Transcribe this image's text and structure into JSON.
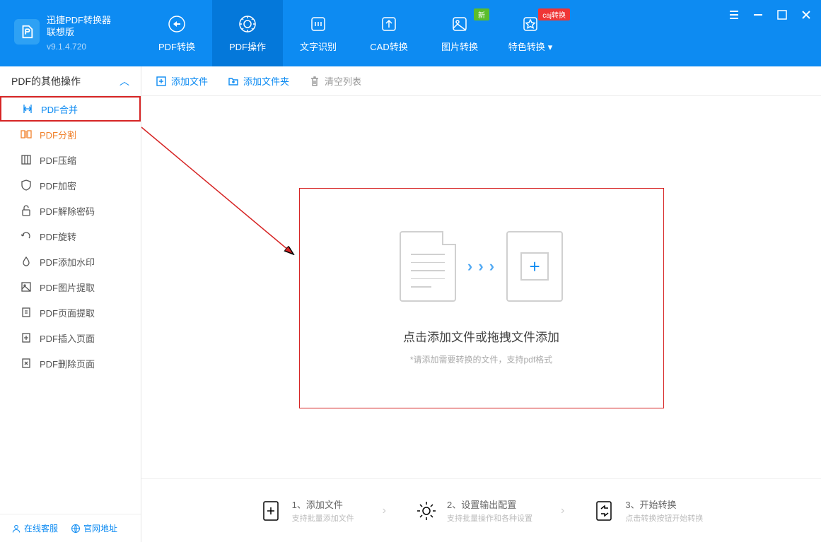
{
  "app": {
    "name": "迅捷PDF转换器\n联想版",
    "version": "v9.1.4.720"
  },
  "nav_tabs": [
    {
      "label": "PDF转换"
    },
    {
      "label": "PDF操作"
    },
    {
      "label": "文字识别"
    },
    {
      "label": "CAD转换"
    },
    {
      "label": "图片转换",
      "badge": "新"
    },
    {
      "label": "特色转换",
      "badge": "caj转换",
      "caret": true
    }
  ],
  "sidebar": {
    "header": "PDF的其他操作",
    "items": [
      {
        "label": "PDF合并"
      },
      {
        "label": "PDF分割"
      },
      {
        "label": "PDF压缩"
      },
      {
        "label": "PDF加密"
      },
      {
        "label": "PDF解除密码"
      },
      {
        "label": "PDF旋转"
      },
      {
        "label": "PDF添加水印"
      },
      {
        "label": "PDF图片提取"
      },
      {
        "label": "PDF页面提取"
      },
      {
        "label": "PDF插入页面"
      },
      {
        "label": "PDF删除页面"
      }
    ],
    "footer": {
      "support": "在线客服",
      "website": "官网地址"
    }
  },
  "toolbar": {
    "add_file": "添加文件",
    "add_folder": "添加文件夹",
    "clear_list": "清空列表"
  },
  "dropzone": {
    "title": "点击添加文件或拖拽文件添加",
    "subtitle": "*请添加需要转换的文件，支持pdf格式"
  },
  "steps": [
    {
      "title": "1、添加文件",
      "subtitle": "支持批量添加文件"
    },
    {
      "title": "2、设置输出配置",
      "subtitle": "支持批量操作和各种设置"
    },
    {
      "title": "3、开始转换",
      "subtitle": "点击转换按钮开始转换"
    }
  ]
}
